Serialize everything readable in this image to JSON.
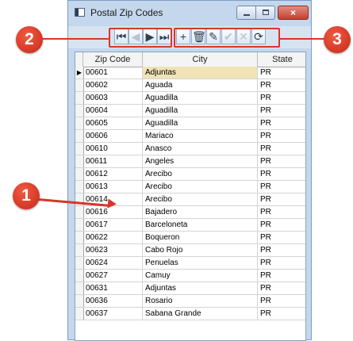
{
  "window": {
    "title": "Postal Zip Codes",
    "close_glyph": "×"
  },
  "navigator": {
    "buttons": [
      {
        "name": "first-record-button",
        "icon": "first-icon",
        "glyph": "⏮",
        "enabled": true
      },
      {
        "name": "prior-record-button",
        "icon": "prior-icon",
        "glyph": "◀",
        "enabled": false
      },
      {
        "name": "next-record-button",
        "icon": "next-icon",
        "glyph": "▶",
        "enabled": true
      },
      {
        "name": "last-record-button",
        "icon": "last-icon",
        "glyph": "⏭",
        "enabled": true
      },
      {
        "name": "insert-record-button",
        "icon": "plus-icon",
        "glyph": "+",
        "enabled": true
      },
      {
        "name": "delete-record-button",
        "icon": "trash-icon",
        "glyph": "🗑",
        "enabled": true
      },
      {
        "name": "edit-record-button",
        "icon": "pencil-icon",
        "glyph": "✎",
        "enabled": true
      },
      {
        "name": "post-edit-button",
        "icon": "check-icon",
        "glyph": "✔",
        "enabled": false
      },
      {
        "name": "cancel-edit-button",
        "icon": "cross-icon",
        "glyph": "✕",
        "enabled": false
      },
      {
        "name": "refresh-data-button",
        "icon": "refresh-icon",
        "glyph": "⟳",
        "enabled": true
      }
    ]
  },
  "grid": {
    "columns": [
      "Zip Code",
      "City",
      "State"
    ],
    "current_row_marker": "▶",
    "rows": [
      {
        "zip": "00601",
        "city": "Adjuntas",
        "state": "PR"
      },
      {
        "zip": "00602",
        "city": "Aguada",
        "state": "PR"
      },
      {
        "zip": "00603",
        "city": "Aguadilla",
        "state": "PR"
      },
      {
        "zip": "00604",
        "city": "Aguadilla",
        "state": "PR"
      },
      {
        "zip": "00605",
        "city": "Aguadilla",
        "state": "PR"
      },
      {
        "zip": "00606",
        "city": "Mariaco",
        "state": "PR"
      },
      {
        "zip": "00610",
        "city": "Anasco",
        "state": "PR"
      },
      {
        "zip": "00611",
        "city": "Angeles",
        "state": "PR"
      },
      {
        "zip": "00612",
        "city": "Arecibo",
        "state": "PR"
      },
      {
        "zip": "00613",
        "city": "Arecibo",
        "state": "PR"
      },
      {
        "zip": "00614",
        "city": "Arecibo",
        "state": "PR"
      },
      {
        "zip": "00616",
        "city": "Bajadero",
        "state": "PR"
      },
      {
        "zip": "00617",
        "city": "Barceloneta",
        "state": "PR"
      },
      {
        "zip": "00622",
        "city": "Boqueron",
        "state": "PR"
      },
      {
        "zip": "00623",
        "city": "Cabo Rojo",
        "state": "PR"
      },
      {
        "zip": "00624",
        "city": "Penuelas",
        "state": "PR"
      },
      {
        "zip": "00627",
        "city": "Camuy",
        "state": "PR"
      },
      {
        "zip": "00631",
        "city": "Adjuntas",
        "state": "PR"
      },
      {
        "zip": "00636",
        "city": "Rosario",
        "state": "PR"
      },
      {
        "zip": "00637",
        "city": "Sabana Grande",
        "state": "PR"
      }
    ]
  },
  "callouts": {
    "one": "1",
    "two": "2",
    "three": "3"
  },
  "colors": {
    "callout_red": "#d7362a",
    "selected_cell": "#f0e3b8",
    "window_frame": "#c4d7ed"
  }
}
